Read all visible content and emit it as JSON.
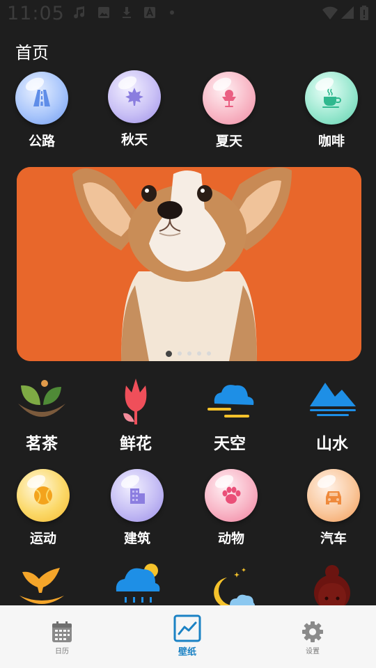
{
  "status_bar": {
    "time": "11:05"
  },
  "page_title": "首页",
  "top_categories": [
    {
      "label": "公路",
      "icon": "road-icon",
      "color": "#8cb5f5"
    },
    {
      "label": "秋天",
      "icon": "maple-leaf-icon",
      "color": "#b8aef0"
    },
    {
      "label": "夏天",
      "icon": "ice-cream-icon",
      "color": "#f4a3b5"
    },
    {
      "label": "咖啡",
      "icon": "coffee-cup-icon",
      "color": "#7fdcc0"
    }
  ],
  "banner": {
    "image": "corgi-puppy-photo",
    "page_count": 5,
    "active_page": 1
  },
  "flat_categories": [
    {
      "label": "茗茶",
      "icon": "tea-leaf-icon"
    },
    {
      "label": "鲜花",
      "icon": "tulip-icon"
    },
    {
      "label": "天空",
      "icon": "cloud-icon"
    },
    {
      "label": "山水",
      "icon": "mountain-water-icon"
    }
  ],
  "round_categories": [
    {
      "label": "运动",
      "icon": "tennis-ball-icon",
      "color": "#f7cf4a"
    },
    {
      "label": "建筑",
      "icon": "building-icon",
      "color": "#b3aaf0"
    },
    {
      "label": "动物",
      "icon": "paw-icon",
      "color": "#f59ab1"
    },
    {
      "label": "汽车",
      "icon": "car-icon",
      "color": "#f7b27a"
    }
  ],
  "partial_categories": [
    {
      "icon": "whale-tail-icon"
    },
    {
      "icon": "rain-cloud-icon"
    },
    {
      "icon": "moon-night-icon"
    },
    {
      "icon": "girl-face-icon"
    }
  ],
  "bottom_nav": [
    {
      "label": "日历",
      "icon": "calendar-icon",
      "active": false
    },
    {
      "label": "壁纸",
      "icon": "wallpaper-chart-icon",
      "active": true
    },
    {
      "label": "设置",
      "icon": "gear-icon",
      "active": false
    }
  ],
  "colors": {
    "background": "#1e1e1e",
    "nav_active": "#1b82c4",
    "nav_bg": "#f6f6f6"
  }
}
